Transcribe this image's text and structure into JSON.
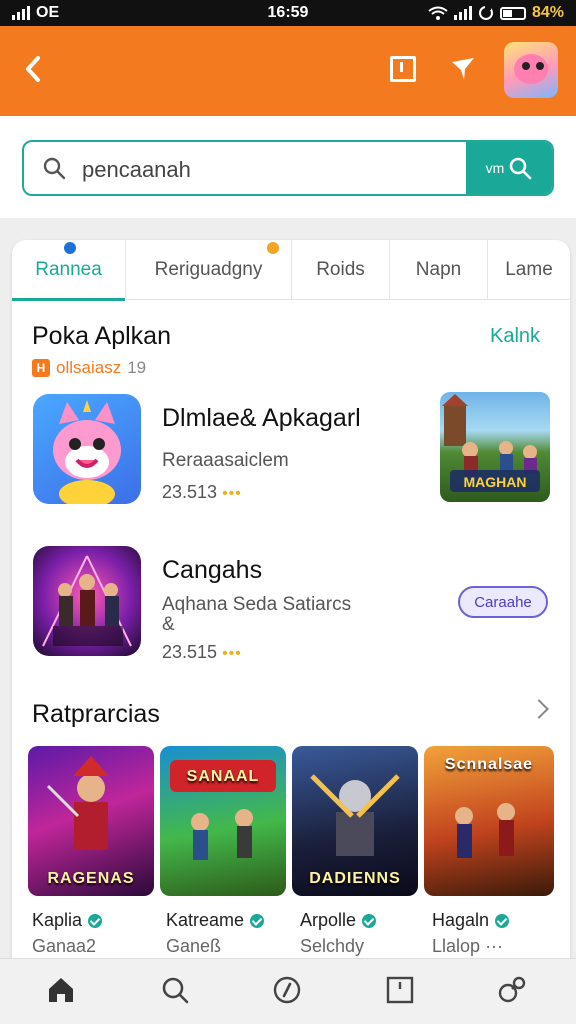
{
  "status_bar": {
    "left": "OE",
    "time": "16:59",
    "battery": "84%"
  },
  "header": {
    "back_icon": "chevron-left-icon",
    "icons": [
      "bookmark-icon",
      "filter-icon"
    ],
    "avatar": "profile-avatar"
  },
  "search": {
    "value": "pencaanah",
    "button_label": "vm"
  },
  "tabs": [
    {
      "label": "Rannea",
      "active": true
    },
    {
      "label": "Reriguadgny",
      "active": false
    },
    {
      "label": "Roids",
      "active": false
    },
    {
      "label": "Napn",
      "active": false
    },
    {
      "label": "Lame",
      "active": false
    }
  ],
  "section1": {
    "title": "Poka Aplkan",
    "link": "Kalnk",
    "subtitle": "ollsaiasz",
    "subtitle_count": "19"
  },
  "apps": [
    {
      "name": "Dlmlae& Apkagarl",
      "desc": "Reraaasaiclem",
      "meta": "23.513"
    },
    {
      "name": "Cangahs",
      "desc": "Aqhana Seda Satiarcs",
      "desc2": "&",
      "meta": "23.515",
      "button": "Caraahe"
    }
  ],
  "section2": {
    "title": "Ratprarcias"
  },
  "tiles": [
    {
      "caption": "RAGENAS",
      "name": "Kaplia",
      "sub": "Ganaa2"
    },
    {
      "caption": "SANAAL",
      "name": "Katreame",
      "sub": "Ganeß"
    },
    {
      "caption": "DADIENNS",
      "name": "Arpolle",
      "sub": "Selchdy"
    },
    {
      "caption": "Scnnalsae",
      "name": "Hagaln",
      "sub": "Llalop"
    }
  ],
  "bottom_nav": [
    "home-icon",
    "search-icon",
    "compass-icon",
    "library-icon",
    "settings-icon"
  ],
  "colors": {
    "accent": "#1aa999",
    "brand": "#f47a20",
    "pill": "#6b62d6"
  }
}
